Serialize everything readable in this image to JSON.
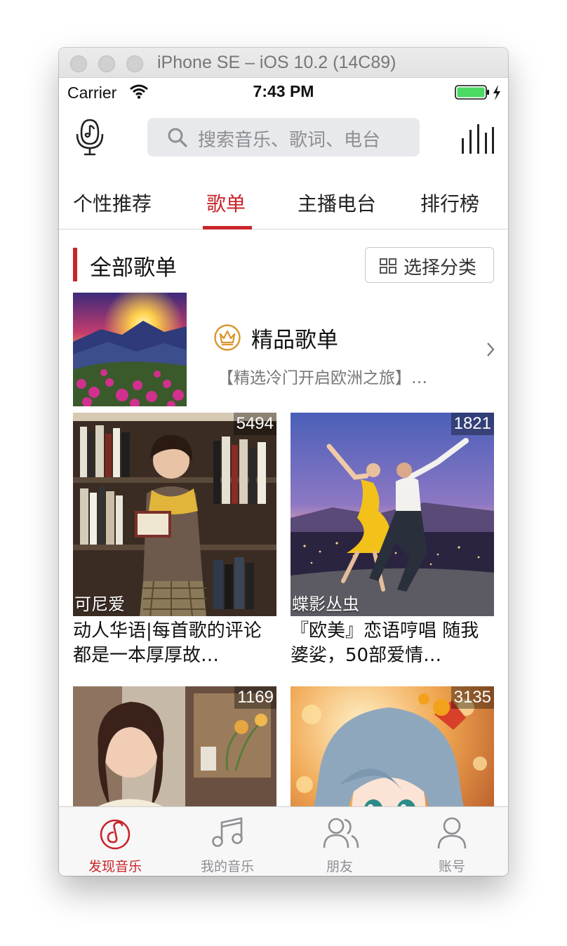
{
  "window": {
    "title": "iPhone SE – iOS 10.2 (14C89)"
  },
  "status_bar": {
    "carrier": "Carrier",
    "time": "7:43 PM"
  },
  "nav": {
    "search_placeholder": "搜索音乐、歌词、电台"
  },
  "tabs": [
    {
      "label": "个性推荐",
      "active": false
    },
    {
      "label": "歌单",
      "active": true
    },
    {
      "label": "主播电台",
      "active": false
    },
    {
      "label": "排行榜",
      "active": false
    }
  ],
  "section": {
    "title": "全部歌单",
    "category_button": "选择分类"
  },
  "premium": {
    "title": "精品歌单",
    "subtitle": "【精选冷门开启欧洲之旅】…"
  },
  "playlists": [
    {
      "count": "5494",
      "creator": "可尼爱",
      "title": "动人华语|每首歌的评论都是一本厚厚故…"
    },
    {
      "count": "1821",
      "creator": "蝶影丛虫",
      "title": "『欧美』恋语哼唱 随我婆娑，50部爱情…"
    },
    {
      "count": "1169",
      "creator": "",
      "title": ""
    },
    {
      "count": "3135",
      "creator": "",
      "title": ""
    }
  ],
  "tab_bar": [
    {
      "label": "发现音乐",
      "icon": "discover-music-icon",
      "active": true
    },
    {
      "label": "我的音乐",
      "icon": "music-note-icon",
      "active": false
    },
    {
      "label": "朋友",
      "icon": "friends-icon",
      "active": false
    },
    {
      "label": "账号",
      "icon": "account-icon",
      "active": false
    }
  ],
  "colors": {
    "accent": "#c8252a",
    "premium_gold": "#d9952f",
    "battery": "#4cd964"
  }
}
